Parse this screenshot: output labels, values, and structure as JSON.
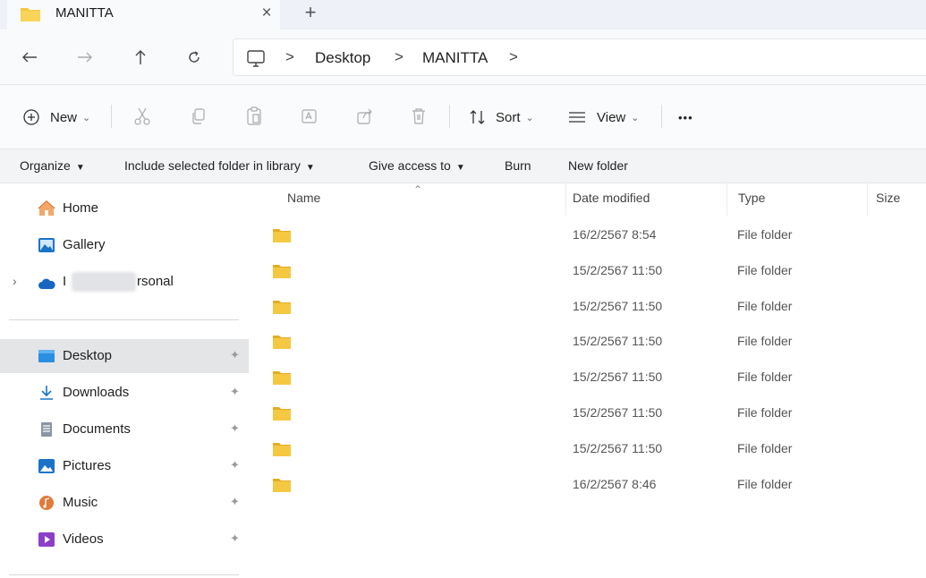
{
  "tab": {
    "title": "MANITTA",
    "close_glyph": "×",
    "new_tab_glyph": "+"
  },
  "nav": {
    "back_icon": "arrow-left-icon",
    "forward_icon": "arrow-right-icon",
    "up_icon": "arrow-up-icon",
    "refresh_icon": "refresh-icon",
    "breadcrumb": [
      "Desktop",
      "MANITTA"
    ],
    "separator": ">"
  },
  "commands": {
    "new_label": "New",
    "sort_label": "Sort",
    "view_label": "View",
    "more_label": "•••"
  },
  "menu": {
    "organize": "Organize",
    "include": "Include selected folder in library",
    "give_access": "Give access to",
    "burn": "Burn",
    "new_folder": "New folder"
  },
  "sidebar": {
    "home": "Home",
    "gallery": "Gallery",
    "onedrive_prefix": "I",
    "onedrive_suffix": "rsonal",
    "desktop": "Desktop",
    "downloads": "Downloads",
    "documents": "Documents",
    "pictures": "Pictures",
    "music": "Music",
    "videos": "Videos",
    "pin_glyph": "✦"
  },
  "columns": {
    "name": "Name",
    "date": "Date modified",
    "type": "Type",
    "size": "Size"
  },
  "rows": [
    {
      "date": "16/2/2567 8:54",
      "type": "File folder"
    },
    {
      "date": "15/2/2567 11:50",
      "type": "File folder"
    },
    {
      "date": "15/2/2567 11:50",
      "type": "File folder"
    },
    {
      "date": "15/2/2567 11:50",
      "type": "File folder"
    },
    {
      "date": "15/2/2567 11:50",
      "type": "File folder"
    },
    {
      "date": "15/2/2567 11:50",
      "type": "File folder"
    },
    {
      "date": "15/2/2567 11:50",
      "type": "File folder"
    },
    {
      "date": "16/2/2567 8:46",
      "type": "File folder"
    }
  ],
  "colors": {
    "folder": "#f5c842",
    "folder_dark": "#e2ad24",
    "selected": "#e4e5e7",
    "accent": "#1a73c8"
  }
}
